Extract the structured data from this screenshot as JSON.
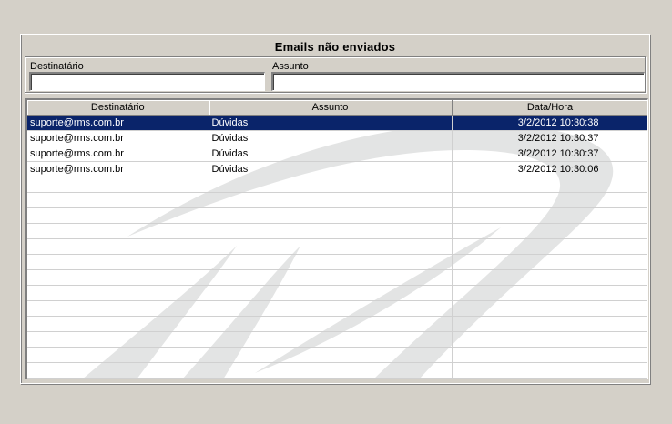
{
  "window": {
    "title": "Emails não enviados"
  },
  "filters": {
    "recipient_label": "Destinatário",
    "recipient_value": "",
    "subject_label": "Assunto",
    "subject_value": ""
  },
  "grid": {
    "columns": [
      "Destinatário",
      "Assunto",
      "Data/Hora"
    ],
    "selected_row_index": 0,
    "selection_color": "#0a246a",
    "rows": [
      {
        "recipient": "suporte@rms.com.br",
        "subject": "Dúvidas",
        "datetime": "3/2/2012 10:30:38"
      },
      {
        "recipient": "suporte@rms.com.br",
        "subject": "Dúvidas",
        "datetime": "3/2/2012 10:30:37"
      },
      {
        "recipient": "suporte@rms.com.br",
        "subject": "Dúvidas",
        "datetime": "3/2/2012 10:30:37"
      },
      {
        "recipient": "suporte@rms.com.br",
        "subject": "Dúvidas",
        "datetime": "3/2/2012 10:30:06"
      }
    ],
    "visible_empty_rows": 13
  },
  "colors": {
    "background": "#d4d0c8",
    "watermark": "#e3e4e4"
  }
}
